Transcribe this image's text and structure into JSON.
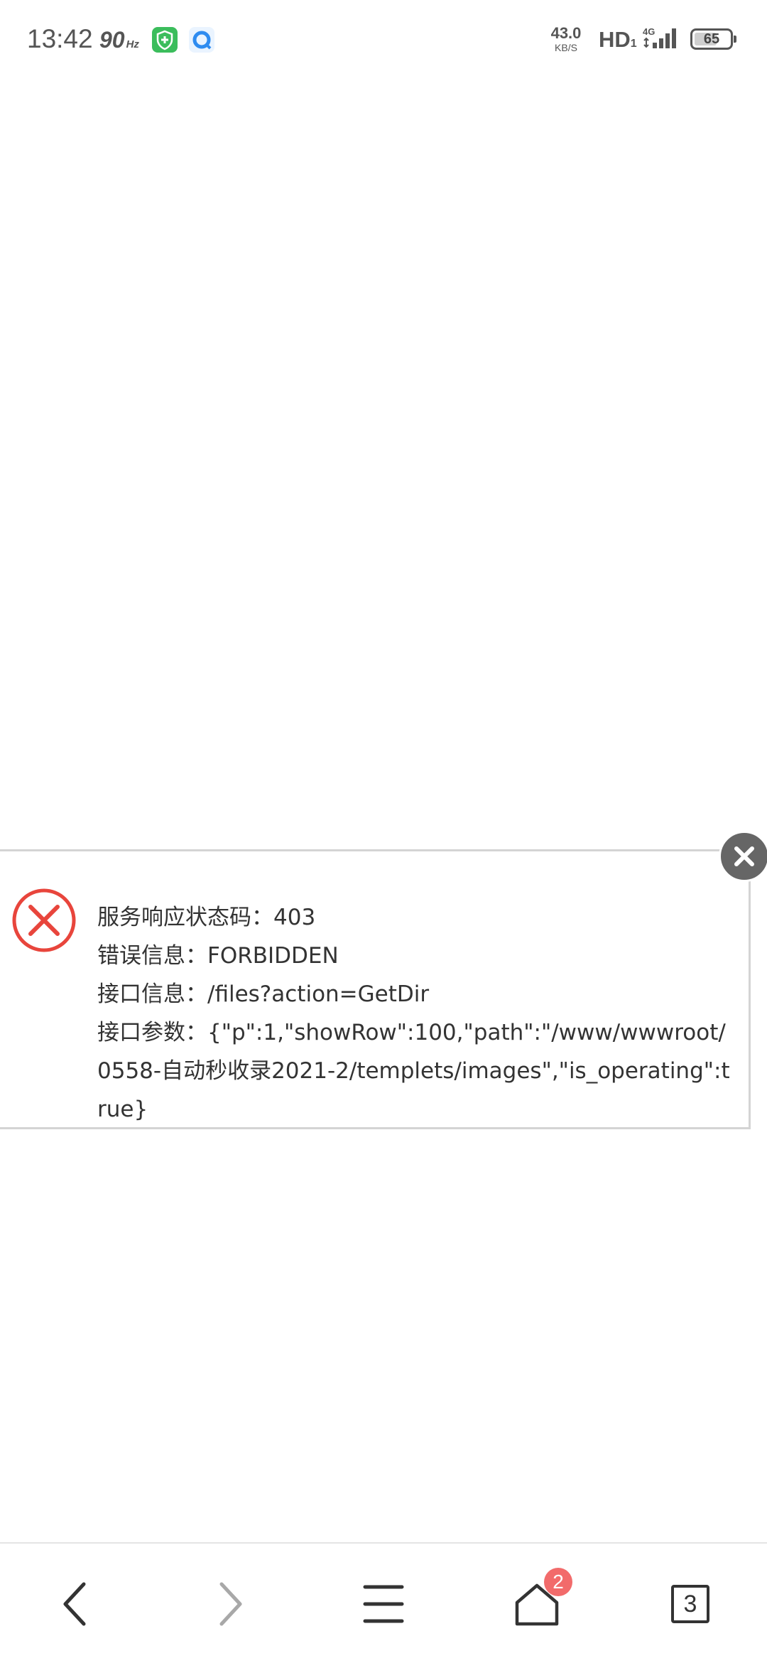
{
  "status_bar": {
    "time": "13:42",
    "refresh_rate": "90",
    "refresh_unit": "Hz",
    "net_speed_value": "43.0",
    "net_speed_unit": "KB/S",
    "hd_label": "HD",
    "hd_sub": "1",
    "network_type": "4G",
    "battery_level": "65",
    "battery_fraction": 0.65,
    "app_icons": [
      "security-shield-icon",
      "browser-app-icon"
    ]
  },
  "error_dialog": {
    "status_line": "服务响应状态码：403",
    "error_line": "错误信息：FORBIDDEN",
    "api_line": "接口信息：/files?action=GetDir",
    "params_line": "接口参数：{\"p\":1,\"showRow\":100,\"path\":\"/www/wwwroot/0558-自动秒收录2021-2/templets/images\",\"is_operating\":true}",
    "icon": "error-x-icon",
    "close_icon": "close-icon",
    "accent_color": "#e8453c"
  },
  "bottom_nav": {
    "items": [
      "back-icon",
      "forward-icon",
      "menu-icon",
      "home-icon",
      "tabs-icon"
    ],
    "home_badge": "2",
    "tab_count": "3"
  }
}
